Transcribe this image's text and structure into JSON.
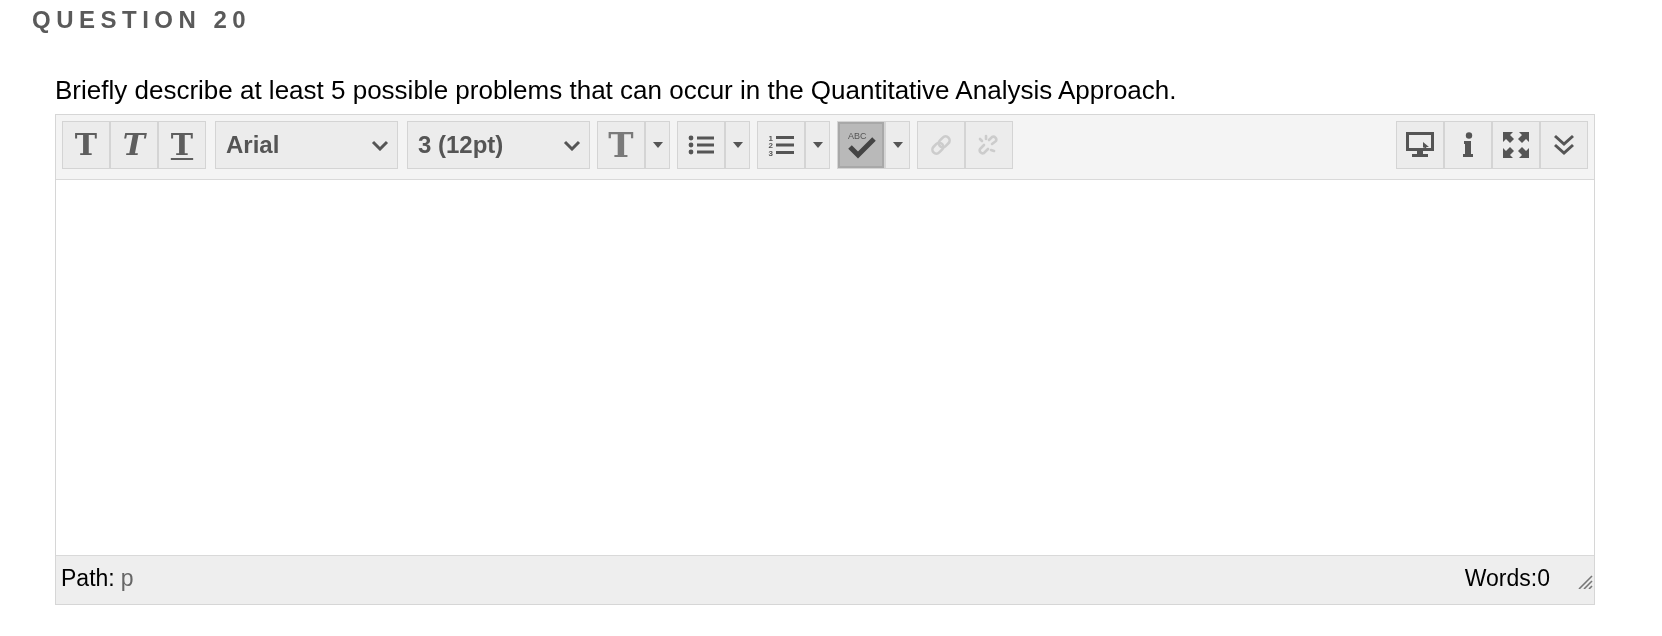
{
  "question": {
    "title": "QUESTION 20",
    "prompt": "Briefly describe at least 5 possible problems that can occur in the Quantitative Analysis Approach."
  },
  "editor": {
    "toolbar": {
      "style_buttons": [
        {
          "kind": "bold",
          "label": "T"
        },
        {
          "kind": "italic",
          "label": "T"
        },
        {
          "kind": "underline",
          "label": "T"
        }
      ],
      "font_family": {
        "value": "Arial"
      },
      "font_size": {
        "value": "3 (12pt)"
      },
      "menu_buttons": [
        {
          "kind": "text-color",
          "label": "T",
          "pressed": false
        },
        {
          "kind": "bullet-list",
          "pressed": false
        },
        {
          "kind": "numbered-list",
          "numbers": [
            "1",
            "2",
            "3"
          ],
          "pressed": false
        },
        {
          "kind": "spellcheck",
          "label": "ABC",
          "pressed": true
        }
      ],
      "link_buttons": [
        {
          "kind": "link",
          "disabled": true
        },
        {
          "kind": "unlink",
          "disabled": true
        }
      ],
      "tool_buttons": [
        {
          "kind": "preview"
        },
        {
          "kind": "info"
        },
        {
          "kind": "fullscreen"
        },
        {
          "kind": "more"
        }
      ]
    },
    "status_bar": {
      "path_label": "Path:",
      "path_element": "p",
      "word_count": "Words:0"
    }
  }
}
